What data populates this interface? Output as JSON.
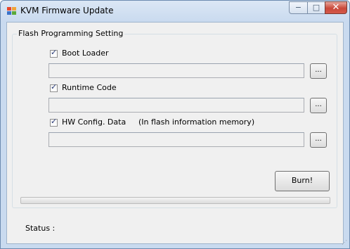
{
  "window": {
    "title": "KVM Firmware Update",
    "controls": {
      "minimize": "−",
      "maximize": "□",
      "close": "✕"
    }
  },
  "group": {
    "label": "Flash Programming Setting",
    "rows": [
      {
        "label": "Boot Loader",
        "note": "",
        "checked": true,
        "path": "",
        "browse": "..."
      },
      {
        "label": "Runtime Code",
        "note": "",
        "checked": true,
        "path": "",
        "browse": "..."
      },
      {
        "label": "HW Config. Data",
        "note": "(In flash information memory)",
        "checked": true,
        "path": "",
        "browse": "..."
      }
    ],
    "burn_button": "Burn!"
  },
  "progress": {
    "value_percent": 0
  },
  "status": {
    "label": "Status :",
    "value": ""
  },
  "icons": {
    "app": "app-windows-icon",
    "grip": "resize-grip-icon"
  }
}
